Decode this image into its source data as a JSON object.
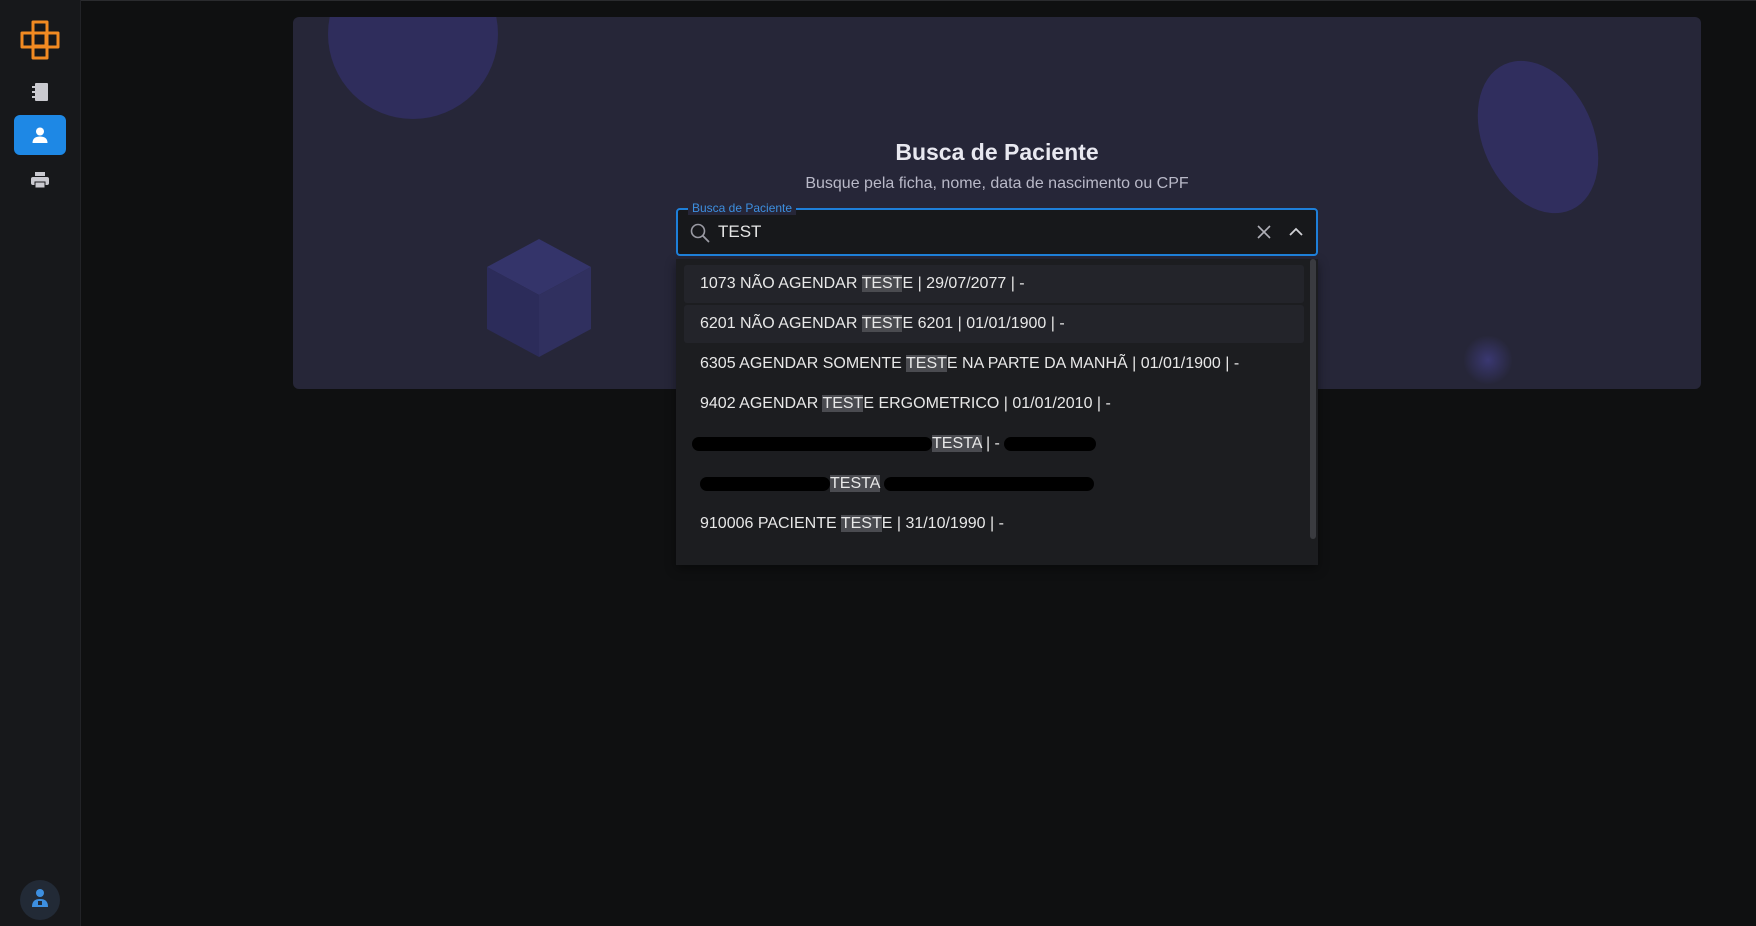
{
  "search": {
    "title": "Busca de Paciente",
    "subtitle": "Busque pela ficha, nome, data de nascimento ou CPF",
    "field_label": "Busca de Paciente",
    "value": "TEST"
  },
  "results": [
    {
      "before": "1073 NÃO AGENDAR ",
      "match": "TEST",
      "after": "E | 29/07/2077 | -"
    },
    {
      "before": "6201 NÃO AGENDAR ",
      "match": "TEST",
      "after": "E 6201 | 01/01/1900 | -"
    },
    {
      "before": "6305 AGENDAR SOMENTE ",
      "match": "TEST",
      "after": "E NA PARTE DA MANHÃ | 01/01/1900 | -"
    },
    {
      "before": "9402 AGENDAR ",
      "match": "TEST",
      "after": "E ERGOMETRICO | 01/01/2010 | -"
    },
    {
      "before": "",
      "match": "TESTA",
      "after": " | -"
    },
    {
      "before": "",
      "match": "TESTA",
      "after": ""
    },
    {
      "before": "910006 PACIENTE ",
      "match": "TEST",
      "after": "E | 31/10/1990 | -"
    }
  ],
  "sidebar": {
    "items": [
      {
        "icon": "notebook-icon"
      },
      {
        "icon": "user-icon",
        "active": true
      },
      {
        "icon": "printer-icon"
      }
    ],
    "bottom_icon": "doctor-avatar-icon"
  },
  "colors": {
    "accent": "#1e88e5",
    "logo": "#f28a22",
    "hero_bg": "#262638",
    "page_bg": "#0f1011"
  }
}
